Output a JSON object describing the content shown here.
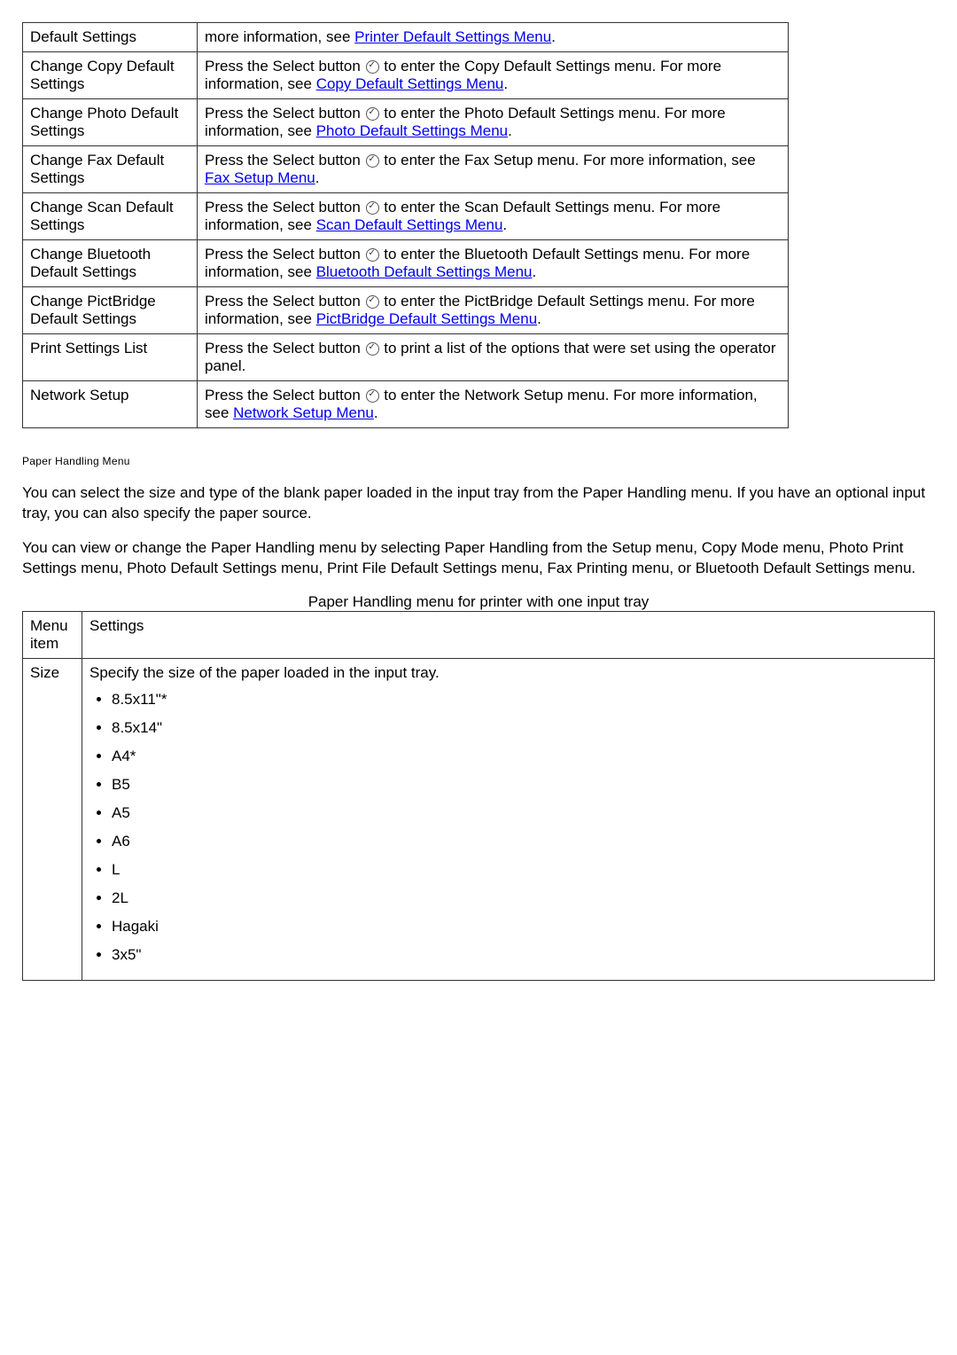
{
  "table1": {
    "rows": [
      {
        "left": "Default Settings",
        "pre": "more information, see ",
        "link": "Printer Default Settings Menu",
        "post": "."
      },
      {
        "left": "Change Copy Default Settings",
        "pre": "Press the Select button ",
        "mid": " to enter the Copy Default Settings menu. For more information, see ",
        "link": "Copy Default Settings Menu",
        "post": "."
      },
      {
        "left": "Change Photo Default Settings",
        "pre": "Press the Select button ",
        "mid": " to enter the Photo Default Settings menu. For more information, see ",
        "link": "Photo Default Settings Menu",
        "post": "."
      },
      {
        "left": "Change Fax Default Settings",
        "pre": "Press the Select button ",
        "mid": " to enter the Fax Setup menu. For more information, see ",
        "link": "Fax Setup Menu",
        "post": "."
      },
      {
        "left": "Change Scan Default Settings",
        "pre": "Press the Select button ",
        "mid": " to enter the Scan Default Settings menu. For more information, see ",
        "link": "Scan Default Settings Menu",
        "post": "."
      },
      {
        "left": "Change Bluetooth Default Settings",
        "pre": "Press the Select button ",
        "mid": " to enter the Bluetooth Default Settings menu. For more information, see ",
        "link": "Bluetooth Default Settings Menu",
        "post": "."
      },
      {
        "left": "Change PictBridge Default Settings",
        "pre": "Press the Select button ",
        "mid": " to enter the PictBridge Default Settings menu. For more information, see ",
        "link": "PictBridge Default Settings Menu",
        "post": "."
      },
      {
        "left": "Print Settings List",
        "pre": "Press the Select button ",
        "mid": " to print a list of the options that were set using the operator panel.",
        "link": "",
        "post": ""
      },
      {
        "left": "Network Setup",
        "pre": "Press the Select button ",
        "mid": " to enter the Network Setup menu. For more information, see ",
        "link": "Network Setup Menu",
        "post": "."
      }
    ]
  },
  "section_heading": "Paper Handling Menu",
  "para1": "You can select the size and type of the blank paper loaded in the input tray from the Paper Handling menu. If you have an optional input tray, you can also specify the paper source.",
  "para2": "You can view or change the Paper Handling menu by selecting Paper Handling from the Setup menu, Copy Mode menu, Photo Print Settings menu, Photo Default Settings menu, Print File Default Settings menu, Fax Printing menu, or Bluetooth Default Settings menu.",
  "caption": "Paper Handling menu for printer with one input tray",
  "table2": {
    "headers": {
      "col0": "Menu item",
      "col1": "Settings"
    },
    "row_label": "Size",
    "row_desc": "Specify the size of the paper loaded in the input tray.",
    "sizes": [
      "8.5x11\"*",
      "8.5x14\"",
      "A4*",
      "B5",
      "A5",
      "A6",
      "L",
      "2L",
      "Hagaki",
      "3x5\""
    ]
  }
}
